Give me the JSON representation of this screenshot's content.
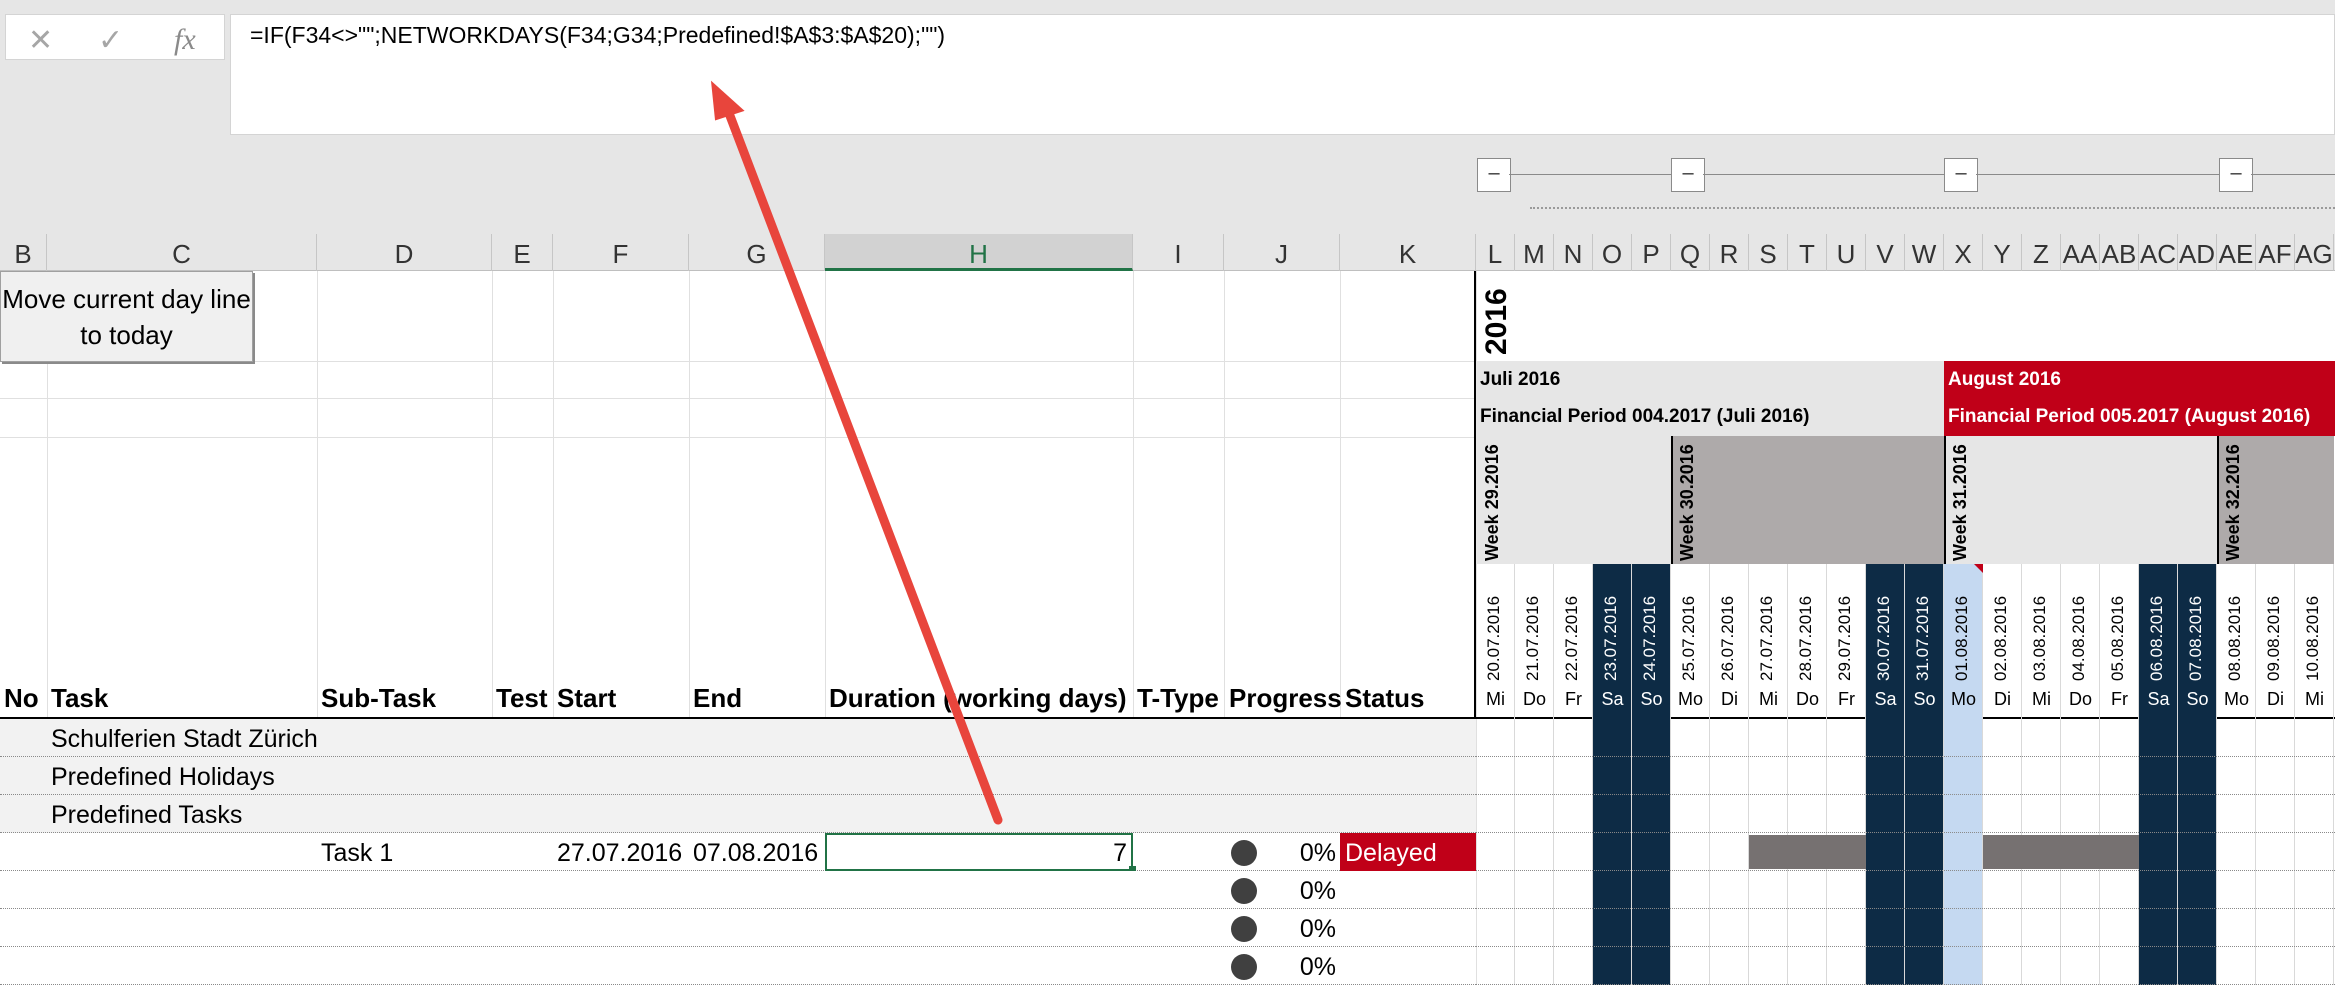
{
  "formula_bar": {
    "cancel_icon": "x-icon",
    "enter_icon": "check-icon",
    "fx_label": "fx",
    "formula": "=IF(F34<>\"\";NETWORKDAYS(F34;G34;Predefined!$A$3:$A$20);\"\")"
  },
  "outline": {
    "collapse_symbol": "–"
  },
  "columns": [
    "B",
    "C",
    "D",
    "E",
    "F",
    "G",
    "H",
    "I",
    "J",
    "K",
    "L",
    "M",
    "N",
    "O",
    "P",
    "Q",
    "R",
    "S",
    "T",
    "U",
    "V",
    "W",
    "X",
    "Y",
    "Z",
    "AA",
    "AB",
    "AC",
    "AD",
    "AE",
    "AF",
    "AG"
  ],
  "selected_column": "H",
  "move_button_label": "Move current day line to today",
  "headers": [
    "No",
    "Task",
    "Sub-Task",
    "Test",
    "Start",
    "End",
    "Duration (working days)",
    "T-Type",
    "Progress",
    "Status"
  ],
  "rows": [
    {
      "task": "Schulferien Stadt Zürich"
    },
    {
      "task": "Predefined Holidays"
    },
    {
      "task": "Predefined Tasks"
    },
    {
      "subtask": "Task 1",
      "start": "27.07.2016",
      "end": "07.08.2016",
      "duration": "7",
      "progress": "0%",
      "status": "Delayed"
    },
    {
      "progress": "0%"
    },
    {
      "progress": "0%"
    },
    {
      "progress": "0%"
    }
  ],
  "gantt": {
    "year": "2016",
    "months": [
      {
        "name": "Juli 2016",
        "period": "Financial Period 004.2017 (Juli 2016)"
      },
      {
        "name": "August 2016",
        "period": "Financial Period 005.2017 (August 2016)"
      }
    ],
    "weeks": [
      "Week 29.2016",
      "Week 30.2016",
      "Week 31.2016",
      "Week 32.2016"
    ],
    "dates": [
      "20.07.2016",
      "21.07.2016",
      "22.07.2016",
      "23.07.2016",
      "24.07.2016",
      "25.07.2016",
      "26.07.2016",
      "27.07.2016",
      "28.07.2016",
      "29.07.2016",
      "30.07.2016",
      "31.07.2016",
      "01.08.2016",
      "02.08.2016",
      "03.08.2016",
      "04.08.2016",
      "05.08.2016",
      "06.08.2016",
      "07.08.2016",
      "08.08.2016",
      "09.08.2016",
      "10.08.2016"
    ],
    "days": [
      "Mi",
      "Do",
      "Fr",
      "Sa",
      "So",
      "Mo",
      "Di",
      "Mi",
      "Do",
      "Fr",
      "Sa",
      "So",
      "Mo",
      "Di",
      "Mi",
      "Do",
      "Fr",
      "Sa",
      "So",
      "Mo",
      "Di",
      "Mi"
    ],
    "today": "01.08.2016",
    "colors": {
      "weekend": "#0d2b45",
      "today": "#c5d9f1",
      "august": "#c00018",
      "july_header": "#e6e6e6",
      "week_grey": "#aeaaaa",
      "task_bar": "#767171",
      "status_delayed": "#c00018"
    }
  }
}
